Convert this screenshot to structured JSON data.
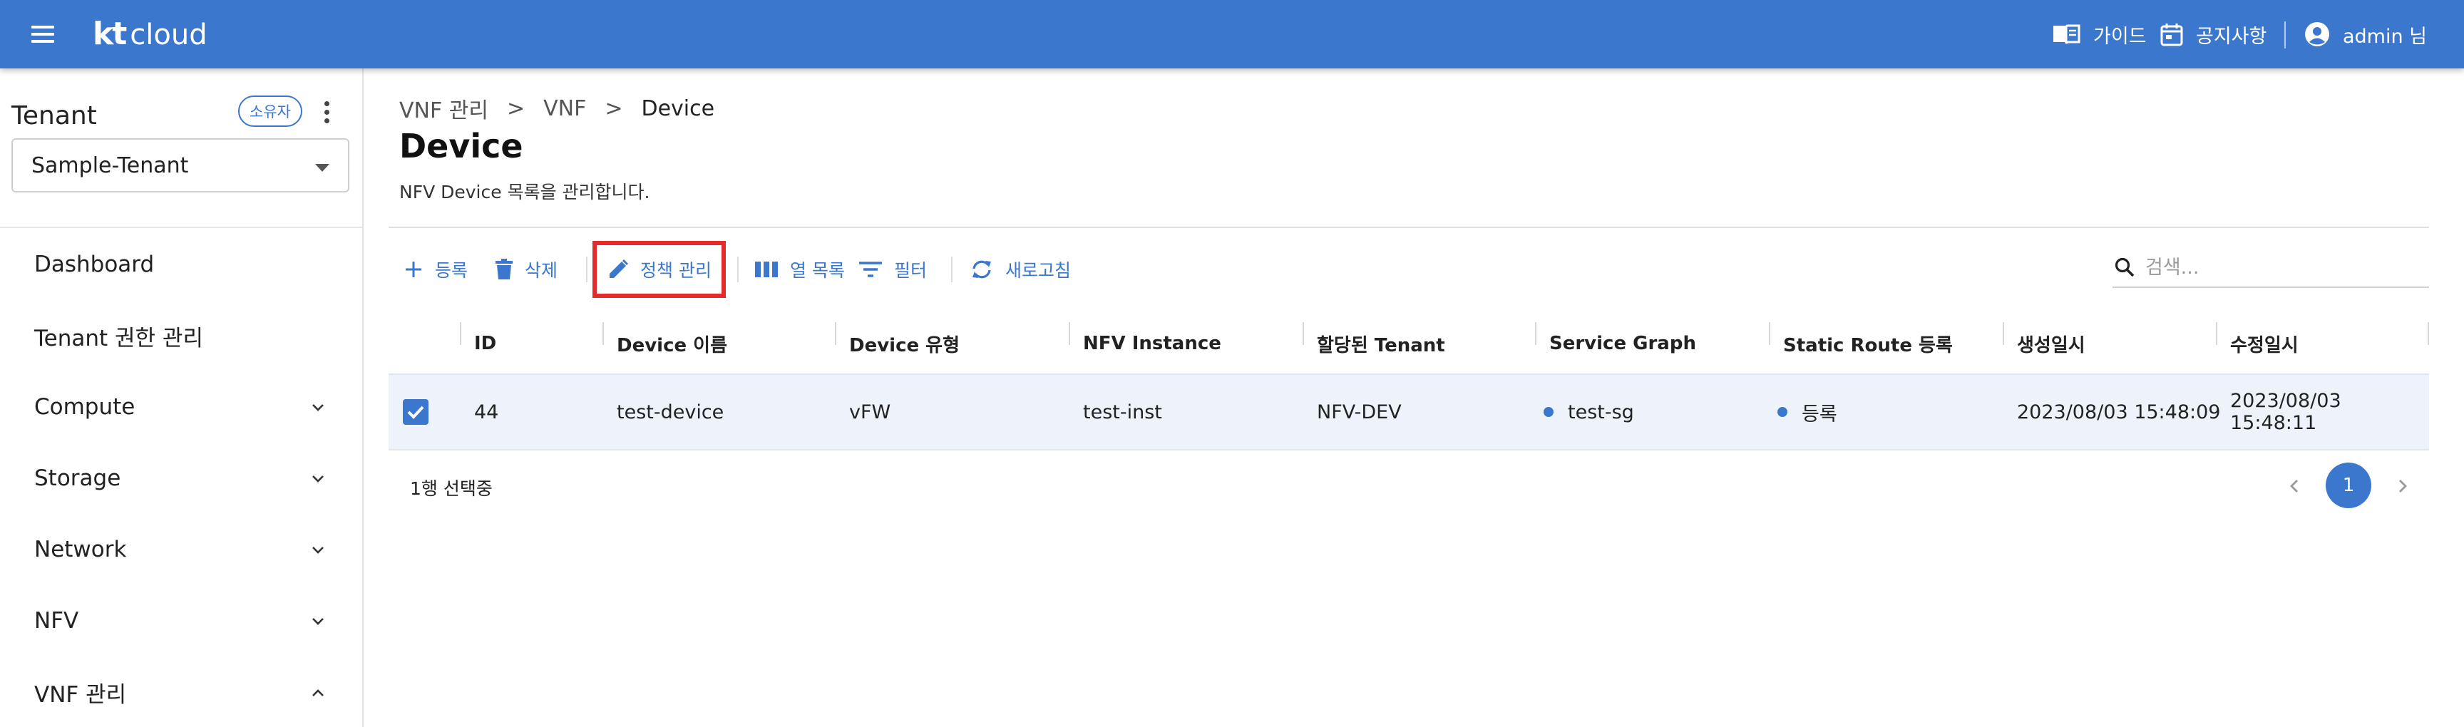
{
  "header": {
    "logo_kt": "kt",
    "logo_cloud": "cloud",
    "guide_label": "가이드",
    "notice_label": "공지사항",
    "user_label": "admin 님"
  },
  "sidebar": {
    "tenant_title": "Tenant",
    "owner_badge": "소유자",
    "tenant_selected": "Sample-Tenant",
    "items": [
      {
        "label": "Dashboard",
        "expandable": false
      },
      {
        "label": "Tenant 권한 관리",
        "expandable": false
      },
      {
        "label": "Compute",
        "expandable": true,
        "expanded": false
      },
      {
        "label": "Storage",
        "expandable": true,
        "expanded": false
      },
      {
        "label": "Network",
        "expandable": true,
        "expanded": false
      },
      {
        "label": "NFV",
        "expandable": true,
        "expanded": false
      },
      {
        "label": "VNF 관리",
        "expandable": true,
        "expanded": true
      }
    ]
  },
  "breadcrumb": {
    "items": [
      "VNF 관리",
      "VNF",
      "Device"
    ],
    "separator": ">"
  },
  "page": {
    "title": "Device",
    "description": "NFV Device 목록을 관리합니다."
  },
  "toolbar": {
    "add": "등록",
    "delete": "삭제",
    "policy": "정책 관리",
    "columns": "열 목록",
    "filter": "필터",
    "refresh": "새로고침",
    "search_placeholder": "검색..."
  },
  "table": {
    "columns": [
      "ID",
      "Device 이름",
      "Device 유형",
      "NFV Instance",
      "할당된 Tenant",
      "Service Graph",
      "Static Route 등록",
      "생성일시",
      "수정일시"
    ],
    "rows": [
      {
        "selected": true,
        "id": "44",
        "device_name": "test-device",
        "device_type": "vFW",
        "nfv_instance": "test-inst",
        "tenant": "NFV-DEV",
        "service_graph": "test-sg",
        "static_route": "등록",
        "created": "2023/08/03 15:48:09",
        "modified": "2023/08/03 15:48:11"
      }
    ]
  },
  "footer": {
    "selection_text": "1행 선택중",
    "current_page": "1"
  },
  "colors": {
    "primary": "#3b77cd",
    "highlight": "#e32b2b",
    "row_selected_bg": "#eef3fb"
  }
}
